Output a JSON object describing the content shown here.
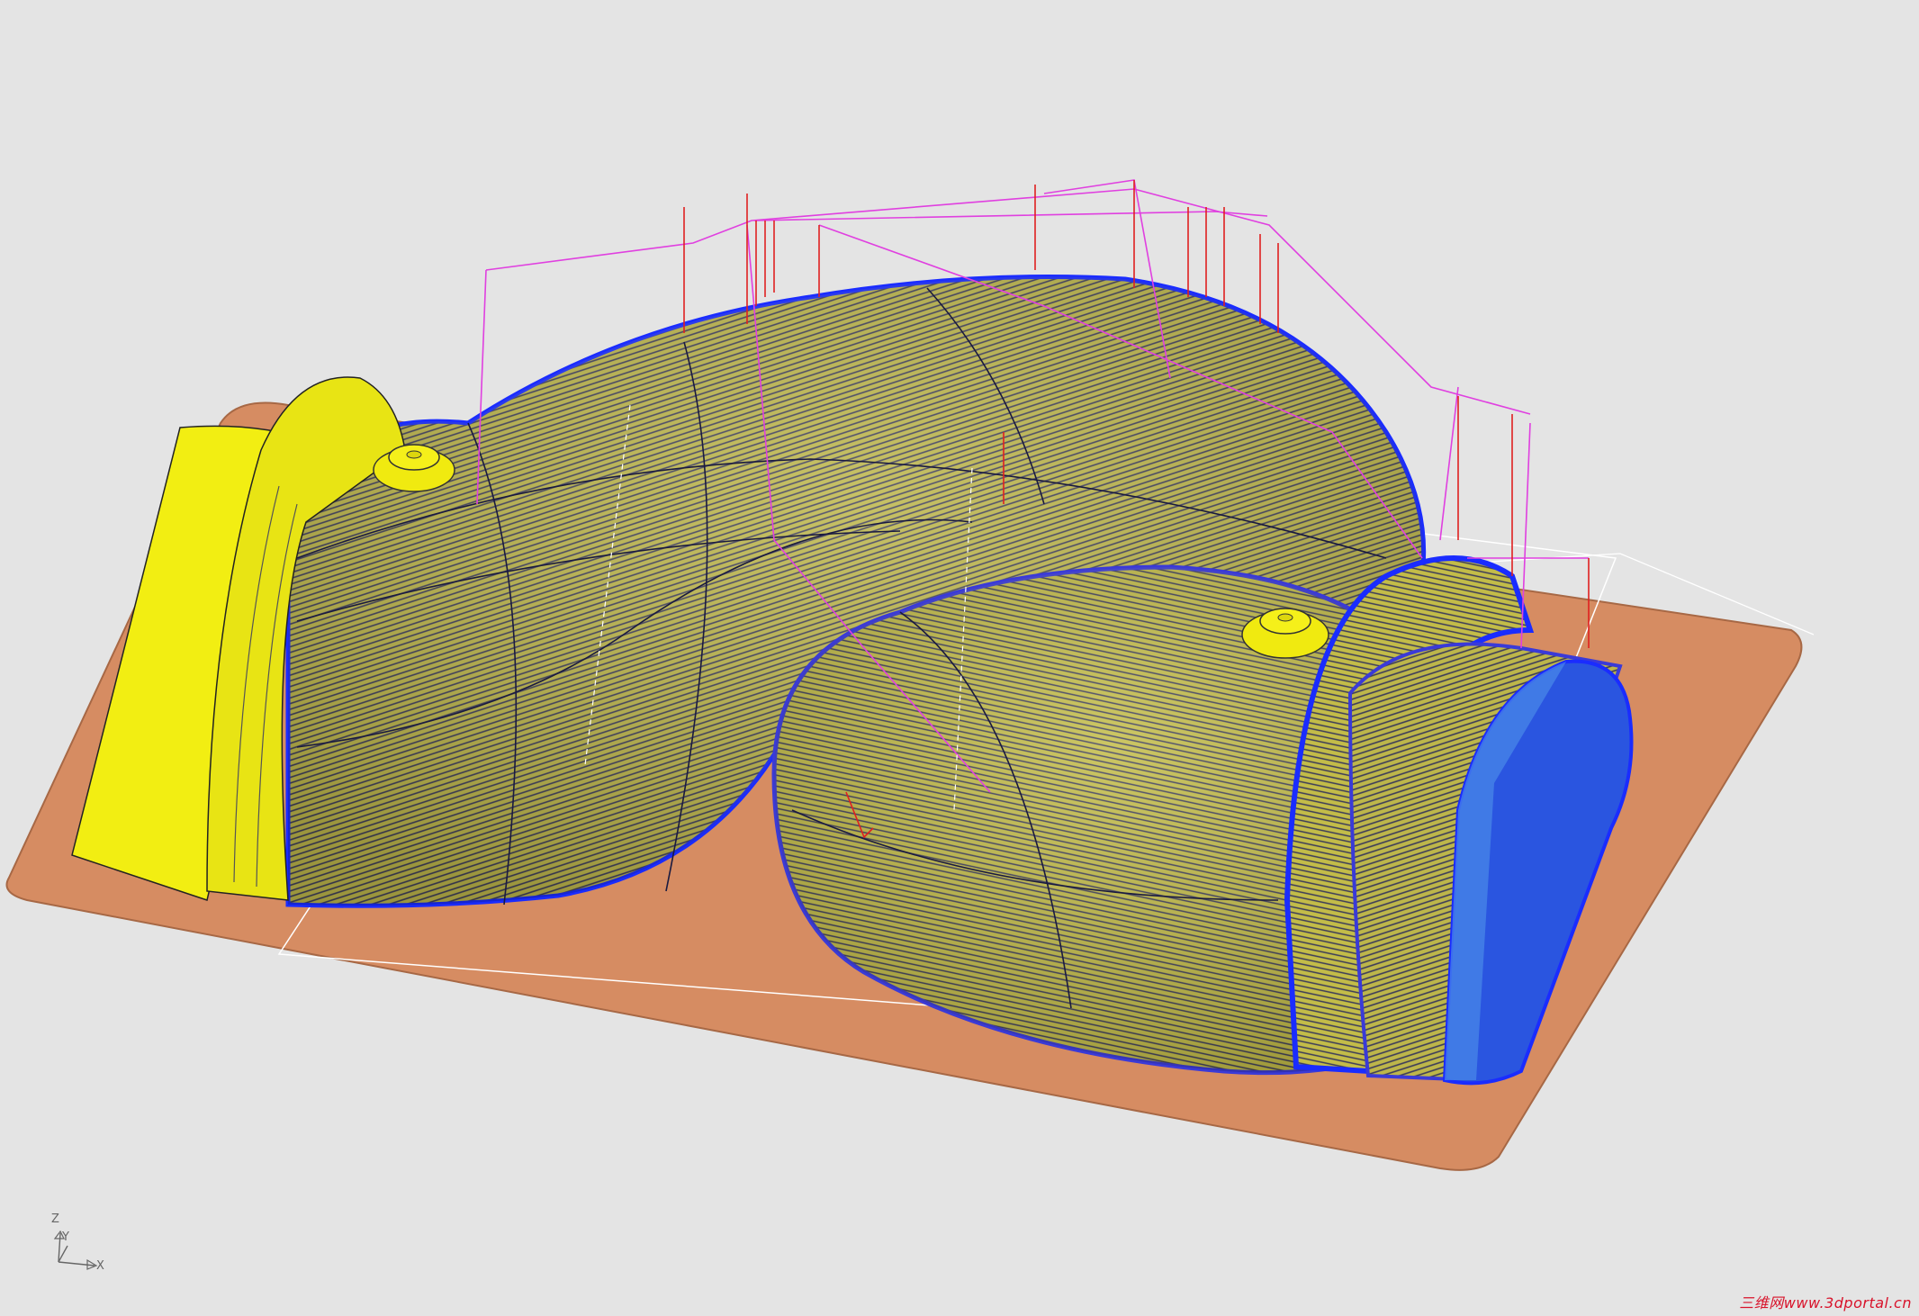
{
  "triad": {
    "z_label": "Z",
    "y_label": "Y",
    "x_label": "X"
  },
  "watermark": {
    "text": "三维网www.3dportal.cn"
  },
  "colors": {
    "background": "#e4e4e4",
    "base_plate": "#d68c62",
    "part_surface": "#c4bd4a",
    "flange_yellow": "#f2ee12",
    "cap_blue": "#2a55e0",
    "toolpath_edge_blue": "#1a2cff",
    "rapid_magenta": "#e040e0",
    "plunge_red": "#e02020",
    "scan_lines": "#2a2a60",
    "boundary_white": "#ffffff"
  },
  "icons": [
    "coordinate-triad-icon"
  ]
}
